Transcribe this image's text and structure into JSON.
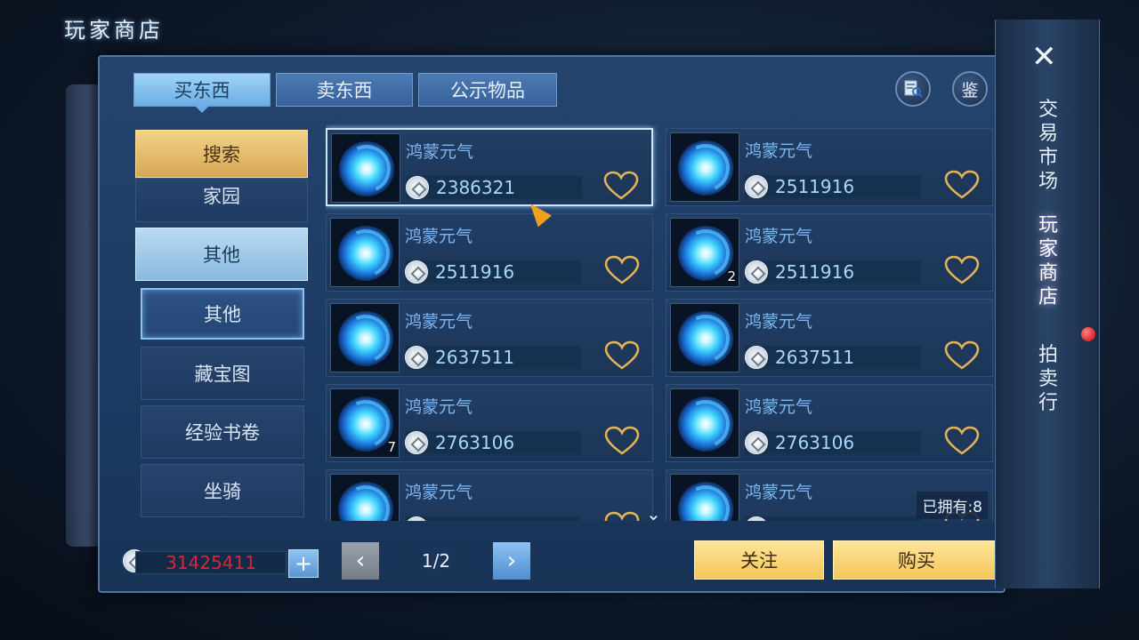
{
  "page_title": "玩家商店",
  "tabs": [
    {
      "label": "买东西",
      "active": true
    },
    {
      "label": "卖东西",
      "active": false
    },
    {
      "label": "公示物品",
      "active": false
    }
  ],
  "top_buttons": {
    "search_icon": "search-record-icon",
    "appraise_label": "鉴"
  },
  "categories": [
    {
      "label": "搜索",
      "state": "search"
    },
    {
      "label": "家园",
      "state": "normal"
    },
    {
      "label": "其他",
      "state": "selected"
    },
    {
      "label": "其他",
      "state": "sub-selected"
    },
    {
      "label": "藏宝图",
      "state": "normal"
    },
    {
      "label": "经验书卷",
      "state": "normal"
    },
    {
      "label": "坐骑",
      "state": "normal"
    }
  ],
  "items": [
    {
      "name": "鸿蒙元气",
      "price": "2386321",
      "count": "",
      "selected": true
    },
    {
      "name": "鸿蒙元气",
      "price": "2511916",
      "count": "",
      "selected": false
    },
    {
      "name": "鸿蒙元气",
      "price": "2511916",
      "count": "",
      "selected": false
    },
    {
      "name": "鸿蒙元气",
      "price": "2511916",
      "count": "2",
      "selected": false
    },
    {
      "name": "鸿蒙元气",
      "price": "2637511",
      "count": "",
      "selected": false
    },
    {
      "name": "鸿蒙元气",
      "price": "2637511",
      "count": "",
      "selected": false
    },
    {
      "name": "鸿蒙元气",
      "price": "2763106",
      "count": "7",
      "selected": false
    },
    {
      "name": "鸿蒙元气",
      "price": "2763106",
      "count": "",
      "selected": false
    },
    {
      "name": "鸿蒙元气",
      "price": "",
      "count": "",
      "selected": false
    },
    {
      "name": "鸿蒙元气",
      "price": "",
      "count": "",
      "selected": false
    }
  ],
  "owned_label": "已拥有:8",
  "footer": {
    "money": "31425411",
    "plus": "+",
    "prev": "‹",
    "next": "›",
    "page_indicator": "1/2",
    "follow_label": "关注",
    "buy_label": "购买"
  },
  "side_nav": {
    "close": "✕",
    "items": [
      {
        "label": "交易市场",
        "active": false
      },
      {
        "label": "玩家商店",
        "active": true
      },
      {
        "label": "拍卖行",
        "active": false
      }
    ]
  },
  "colors": {
    "price_text": "#a9d6ff",
    "money_text": "#e02238",
    "item_name": "#7eb6f0",
    "gold_button": "#f2c659"
  }
}
